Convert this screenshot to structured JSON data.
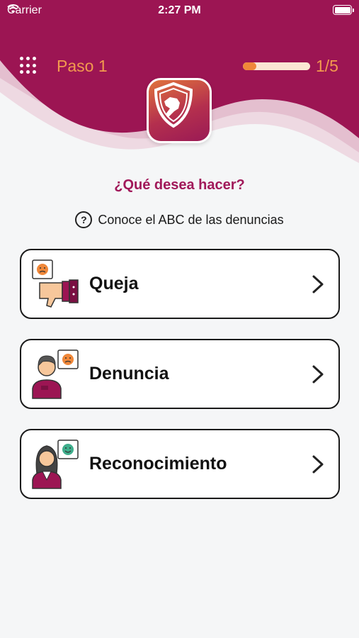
{
  "status_bar": {
    "carrier": "Carrier",
    "time": "2:27 PM"
  },
  "header": {
    "step_title": "Paso 1",
    "progress_fraction": 0.2,
    "progress_count": "1/5"
  },
  "colors": {
    "header_primary": "#9c1553",
    "accent_orange": "#f29a4e",
    "question_text": "#a1195a",
    "background": "#f5f6f7"
  },
  "main": {
    "question": "¿Qué desea hacer?",
    "abc_link": "Conoce el ABC de las denuncias",
    "options": [
      {
        "label": "Queja",
        "icon": "thumbs-down-complaint-icon"
      },
      {
        "label": "Denuncia",
        "icon": "man-report-icon"
      },
      {
        "label": "Reconocimiento",
        "icon": "woman-recognition-icon"
      }
    ]
  }
}
